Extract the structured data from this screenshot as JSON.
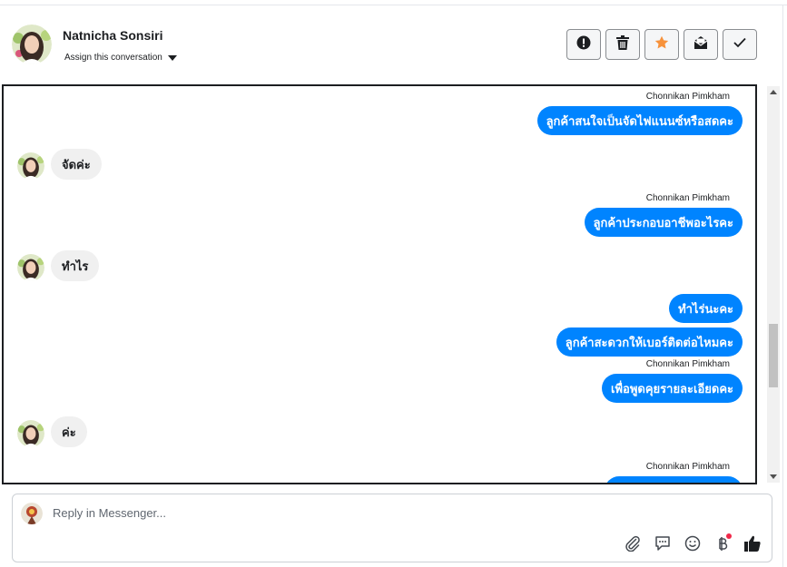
{
  "header": {
    "contact_name": "Natnicha Sonsiri",
    "assign_label": "Assign this conversation",
    "actions": [
      {
        "name": "mark-spam",
        "icon": "exclamation-circle-icon"
      },
      {
        "name": "delete",
        "icon": "trash-icon"
      },
      {
        "name": "star",
        "icon": "star-icon",
        "color": "#f7923b"
      },
      {
        "name": "mark-unread",
        "icon": "envelope-icon"
      },
      {
        "name": "mark-done",
        "icon": "check-icon"
      }
    ]
  },
  "messages": [
    {
      "direction": "out",
      "sender": "Chonnikan Pimkham",
      "text": "ลูกค้าสนใจเป็นจัดไฟแนนซ์หรือสดคะ"
    },
    {
      "direction": "in",
      "text": "จัดค่ะ"
    },
    {
      "direction": "out",
      "sender": "Chonnikan Pimkham",
      "text": "ลูกค้าประกอบอาชีพอะไรคะ"
    },
    {
      "direction": "in",
      "text": "ทำไร"
    },
    {
      "direction": "out",
      "text": "ทำไร่นะคะ"
    },
    {
      "direction": "out",
      "text": "ลูกค้าสะดวกให้เบอร์ติดต่อไหมคะ"
    },
    {
      "direction": "out",
      "sender": "Chonnikan Pimkham",
      "text": "เพื่อพูดคุยรายละเอียดคะ"
    },
    {
      "direction": "in",
      "text": "ค่ะ"
    },
    {
      "direction": "out",
      "sender": "Chonnikan Pimkham",
      "text": ""
    }
  ],
  "composer": {
    "placeholder": "Reply in Messenger...",
    "tools": [
      "paperclip-icon",
      "saved-reply-icon",
      "emoji-icon",
      "baht-payment-icon",
      "thumbs-up-icon"
    ]
  },
  "colors": {
    "outgoing_bubble": "#0084ff",
    "incoming_bubble": "#f0f0f0",
    "star": "#f7923b",
    "notification_dot": "#f02849"
  }
}
